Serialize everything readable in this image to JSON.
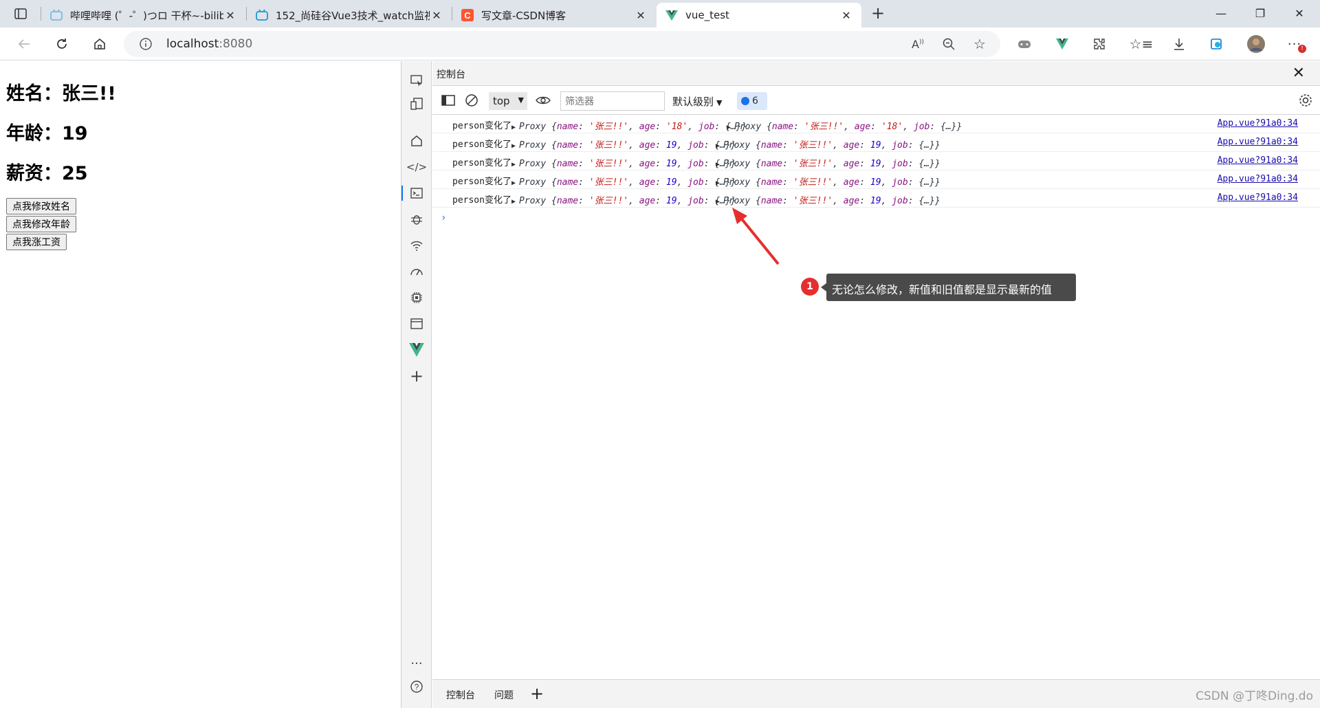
{
  "browser": {
    "tabs": [
      {
        "title": "哔哩哔哩 (゜-゜)つロ 干杯~-bilibili",
        "favicon": "bilibili-icon"
      },
      {
        "title": "152_尚硅谷Vue3技术_watch监视",
        "favicon": "bilibili-icon"
      },
      {
        "title": "写文章-CSDN博客",
        "favicon": "csdn-icon"
      },
      {
        "title": "vue_test",
        "favicon": "vue-icon",
        "active": true
      }
    ],
    "url_host": "localhost",
    "url_port": ":8080"
  },
  "page": {
    "name_line": "姓名：张三!!",
    "age_line": "年龄：19",
    "salary_line": "薪资：25",
    "buttons": [
      "点我修改姓名",
      "点我修改年龄",
      "点我涨工资"
    ]
  },
  "devtools": {
    "panel_title": "控制台",
    "context": "top",
    "filter_placeholder": "筛选器",
    "level": "默认级别",
    "message_count": "6",
    "log_rows": [
      {
        "label": "person变化了",
        "new_age": "'18'",
        "old_age": "'18'",
        "source": "App.vue?91a0:34"
      },
      {
        "label": "person变化了",
        "new_age": "19",
        "old_age": "19",
        "source": "App.vue?91a0:34"
      },
      {
        "label": "person变化了",
        "new_age": "19",
        "old_age": "19",
        "source": "App.vue?91a0:34"
      },
      {
        "label": "person变化了",
        "new_age": "19",
        "old_age": "19",
        "source": "App.vue?91a0:34"
      },
      {
        "label": "person变化了",
        "new_age": "19",
        "old_age": "19",
        "source": "App.vue?91a0:34"
      }
    ],
    "proxy_name": "'张三!!'",
    "drawer_tabs": [
      "控制台",
      "问题"
    ]
  },
  "annotation": {
    "number": "1",
    "text": "无论怎么修改，新值和旧值都是显示最新的值"
  },
  "watermark": "CSDN @丁咚Ding.do",
  "colors": {
    "accent": "#1a73e8",
    "annotation_red": "#e62e2e",
    "vue_green": "#41b883"
  }
}
